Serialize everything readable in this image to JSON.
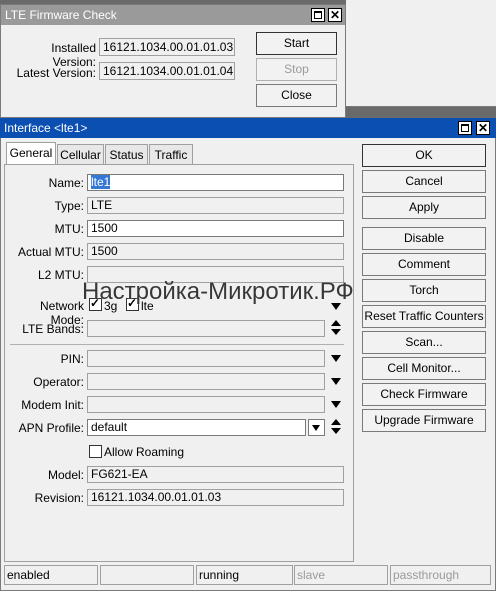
{
  "colors": {
    "active_title": "#0b4fb3",
    "inactive_title": "#9a9a9a"
  },
  "fw_check": {
    "title": "LTE Firmware Check",
    "installed_label": "Installed Version:",
    "installed_value": "16121.1034.00.01.01.03",
    "latest_label": "Latest Version:",
    "latest_value": "16121.1034.00.01.01.04",
    "start": "Start",
    "stop": "Stop",
    "close": "Close"
  },
  "iface": {
    "title": "Interface <lte1>",
    "tabs": [
      "General",
      "Cellular",
      "Status",
      "Traffic"
    ],
    "fields": {
      "name_label": "Name:",
      "name_value": "lte1",
      "type_label": "Type:",
      "type_value": "LTE",
      "mtu_label": "MTU:",
      "mtu_value": "1500",
      "actual_mtu_label": "Actual MTU:",
      "actual_mtu_value": "1500",
      "l2mtu_label": "L2 MTU:",
      "l2mtu_value": "",
      "network_mode_label": "Network Mode:",
      "mode_3g": "3g",
      "mode_lte": "lte",
      "lte_bands_label": "LTE Bands:",
      "lte_bands_value": "",
      "pin_label": "PIN:",
      "pin_value": "",
      "operator_label": "Operator:",
      "operator_value": "",
      "modem_init_label": "Modem Init:",
      "modem_init_value": "",
      "apn_label": "APN Profile:",
      "apn_value": "default",
      "allow_roaming_label": "Allow Roaming",
      "model_label": "Model:",
      "model_value": "FG621-EA",
      "revision_label": "Revision:",
      "revision_value": "16121.1034.00.01.01.03"
    },
    "buttons": [
      "OK",
      "Cancel",
      "Apply",
      "Disable",
      "Comment",
      "Torch",
      "Reset Traffic Counters",
      "Scan...",
      "Cell Monitor...",
      "Check Firmware",
      "Upgrade Firmware"
    ],
    "status": [
      "enabled",
      "",
      "",
      "running",
      "slave",
      "passthrough"
    ]
  },
  "watermark": "Настройка-Микротик.РФ"
}
